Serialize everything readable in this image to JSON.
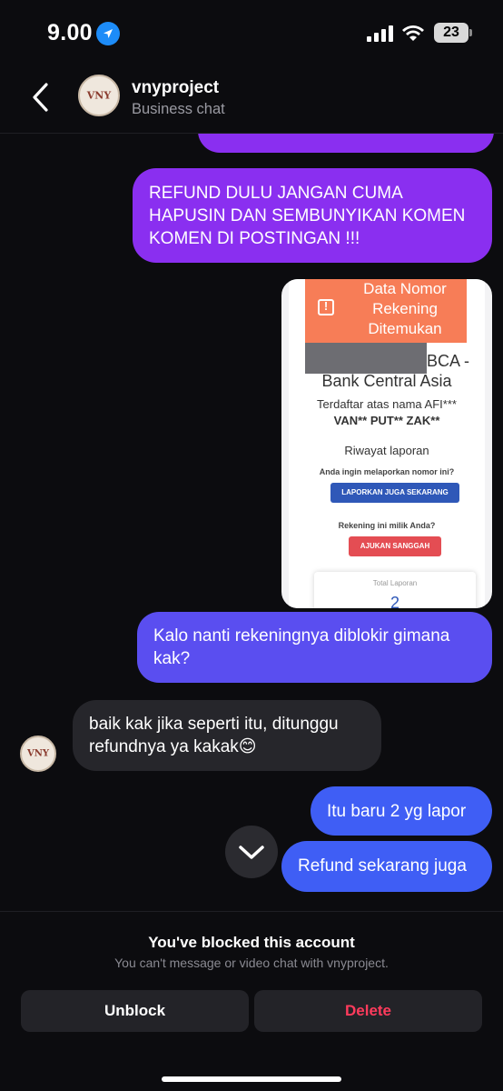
{
  "status_bar": {
    "time": "9.00",
    "battery": "23",
    "icons": [
      "location-arrow-icon",
      "cellular-signal-icon",
      "wifi-icon",
      "battery-icon"
    ]
  },
  "header": {
    "title": "vnyproject",
    "subtitle": "Business chat",
    "avatar_text": "VNY",
    "icons": [
      "back-chevron-icon"
    ]
  },
  "messages": {
    "refund_demand": "REFUND DULU JANGAN CUMA HAPUSIN DAN SEMBUNYIKAN KOMEN KOMEN DI POSTINGAN !!!",
    "kalo": "Kalo nanti rekeningnya diblokir gimana kak?",
    "baik": "baik kak jika seperti itu, ditunggu refundnya ya kakak😊",
    "itu": "Itu baru 2 yg lapor",
    "refund_now": "Refund sekarang juga"
  },
  "screenshot_card": {
    "alert_title": "Data Nomor Rekening Ditemukan",
    "bank_short": "BCA -",
    "bank_full": "Bank Central Asia",
    "registered_label": "Terdaftar atas nama AFI***",
    "registered_name": "VAN** PUT** ZAK**",
    "history": "Riwayat laporan",
    "report_question": "Anda ingin melaporkan nomor ini?",
    "report_button": "LAPORKAN JUGA SEKARANG",
    "owner_question": "Rekening ini milik Anda?",
    "dispute_button": "AJUKAN SANGGAH",
    "total_label": "Total Laporan",
    "total_value": "2"
  },
  "blocked": {
    "title": "You've blocked this account",
    "subtitle": "You can't message or video chat with vnyproject.",
    "unblock": "Unblock",
    "delete": "Delete"
  },
  "colors": {
    "purple": "#8a2ff0",
    "violet": "#5a4ef0",
    "blue": "#3f5ef5",
    "incoming": "#26262b",
    "delete": "#ff3b5c"
  }
}
